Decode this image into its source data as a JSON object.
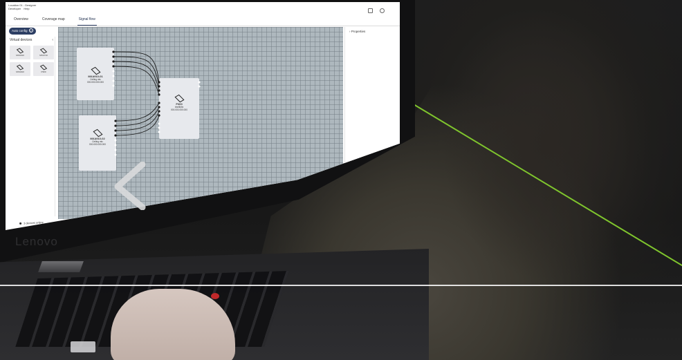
{
  "titlebar": {
    "app_title": "Location 01 - Designer",
    "menu": [
      "Developer",
      "Help"
    ]
  },
  "tabs": [
    {
      "label": "Overview",
      "active": false
    },
    {
      "label": "Coverage map",
      "active": false
    },
    {
      "label": "Signal flow",
      "active": true
    }
  ],
  "toolbar": {
    "auto_config_label": "Auto config",
    "help_glyph": "?"
  },
  "sidebar": {
    "title": "Virtual devices",
    "collapse_glyph": "‹",
    "devices": [
      {
        "label": "MXA310",
        "icon": "device-icon"
      },
      {
        "label": "MXA710",
        "icon": "device-icon"
      },
      {
        "label": "MXA910",
        "icon": "device-icon"
      },
      {
        "label": "P300",
        "icon": "device-icon"
      }
    ]
  },
  "canvas": {
    "nodes": [
      {
        "name": "MXA910-01",
        "sub": "Ceiling mic",
        "ip": "000.000.000.000"
      },
      {
        "name": "MXA910-02",
        "sub": "Ceiling mic",
        "ip": "000.000.000.000"
      },
      {
        "name": "P300",
        "sub": "IntelliMix",
        "ip": "000.000.000.000"
      }
    ]
  },
  "properties": {
    "title": "Properties",
    "expand_glyph": "›"
  },
  "status_bar": {
    "text": "3 devices online"
  },
  "laptop": {
    "brand": "Lenovo"
  },
  "colors": {
    "accent": "#2c3e63",
    "canvas_bg": "#aeb8be",
    "cable_green": "#7fc52d",
    "trackpoint_red": "#c0282a"
  }
}
